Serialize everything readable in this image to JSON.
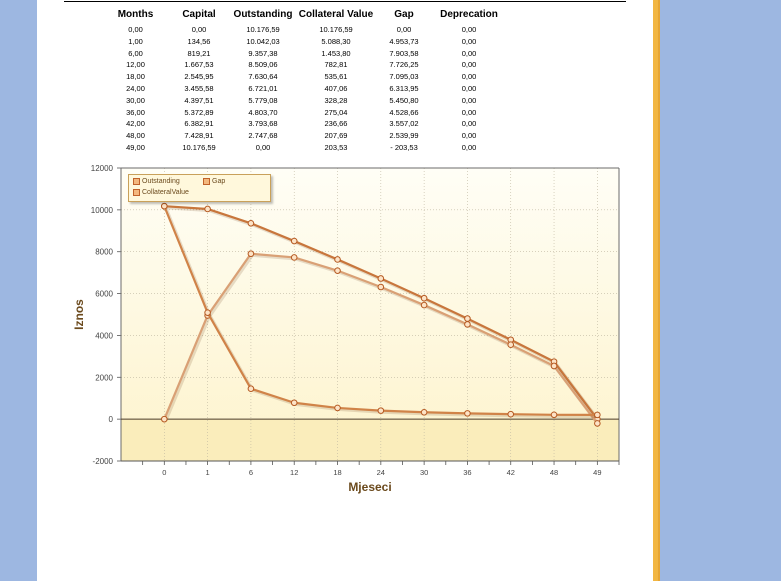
{
  "table": {
    "headers": [
      "Months",
      "Capital",
      "Outstanding",
      "Collateral Value",
      "Gap",
      "Deprecation"
    ],
    "rows": [
      [
        "0,00",
        "0,00",
        "10.176,59",
        "10.176,59",
        "0,00",
        "0,00"
      ],
      [
        "1,00",
        "134,56",
        "10.042,03",
        "5.088,30",
        "4.953,73",
        "0,00"
      ],
      [
        "6,00",
        "819,21",
        "9.357,38",
        "1.453,80",
        "7.903,58",
        "0,00"
      ],
      [
        "12,00",
        "1.667,53",
        "8.509,06",
        "782,81",
        "7.726,25",
        "0,00"
      ],
      [
        "18,00",
        "2.545,95",
        "7.630,64",
        "535,61",
        "7.095,03",
        "0,00"
      ],
      [
        "24,00",
        "3.455,58",
        "6.721,01",
        "407,06",
        "6.313,95",
        "0,00"
      ],
      [
        "30,00",
        "4.397,51",
        "5.779,08",
        "328,28",
        "5.450,80",
        "0,00"
      ],
      [
        "36,00",
        "5.372,89",
        "4.803,70",
        "275,04",
        "4.528,66",
        "0,00"
      ],
      [
        "42,00",
        "6.382,91",
        "3.793,68",
        "236,66",
        "3.557,02",
        "0,00"
      ],
      [
        "48,00",
        "7.428,91",
        "2.747,68",
        "207,69",
        "2.539,99",
        "0,00"
      ],
      [
        "49,00",
        "10.176,59",
        "0,00",
        "203,53",
        "- 203,53",
        "0,00"
      ]
    ]
  },
  "chart_data": {
    "type": "line",
    "categories": [
      "0",
      "1",
      "6",
      "12",
      "18",
      "24",
      "30",
      "36",
      "42",
      "48",
      "49"
    ],
    "series": [
      {
        "name": "Outstanding",
        "values": [
          10176.59,
          10042.03,
          9357.38,
          8509.06,
          7630.64,
          6721.01,
          5779.08,
          4803.7,
          3793.68,
          2747.68,
          0
        ]
      },
      {
        "name": "Gap",
        "values": [
          0,
          4953.73,
          7903.58,
          7726.25,
          7095.03,
          6313.95,
          5450.8,
          4528.66,
          3557.02,
          2539.99,
          -203.53
        ]
      },
      {
        "name": "CollateralValue",
        "values": [
          10176.59,
          5088.3,
          1453.8,
          782.81,
          535.61,
          407.06,
          328.28,
          275.04,
          236.66,
          207.69,
          203.53
        ]
      }
    ],
    "xlabel": "Mjeseci",
    "ylabel": "Iznos",
    "ylim": [
      -2000,
      12000
    ],
    "yticks": [
      "12000",
      "10000",
      "8000",
      "6000",
      "4000",
      "2000",
      "0",
      "-2000"
    ],
    "grid": true,
    "legend": "top-left",
    "colors": {
      "outstanding": "#c8763c",
      "gap": "#d9a075",
      "collateral": "#d08348",
      "plot_bg_top": "#fffef6",
      "plot_bg_bottom": "#fdf3cc",
      "negative_band": "#faedbb"
    }
  }
}
